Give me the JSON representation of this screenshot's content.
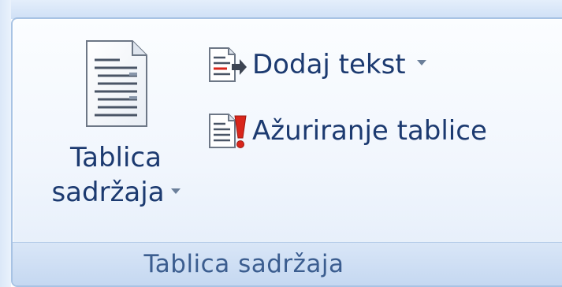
{
  "ribbon_group": {
    "title": "Tablica sadržaja",
    "toc_button": {
      "label_line1": "Tablica",
      "label_line2": "sadržaja",
      "icon": "document-toc-icon"
    },
    "add_text_button": {
      "label": "Dodaj tekst",
      "icon": "add-text-icon"
    },
    "update_table_button": {
      "label": "Ažuriranje tablice",
      "icon": "update-table-icon"
    }
  },
  "colors": {
    "label_text": "#1c3a70",
    "group_title": "#3b5d8f",
    "border": "#a8c3e4",
    "accent_red": "#d9261c"
  }
}
